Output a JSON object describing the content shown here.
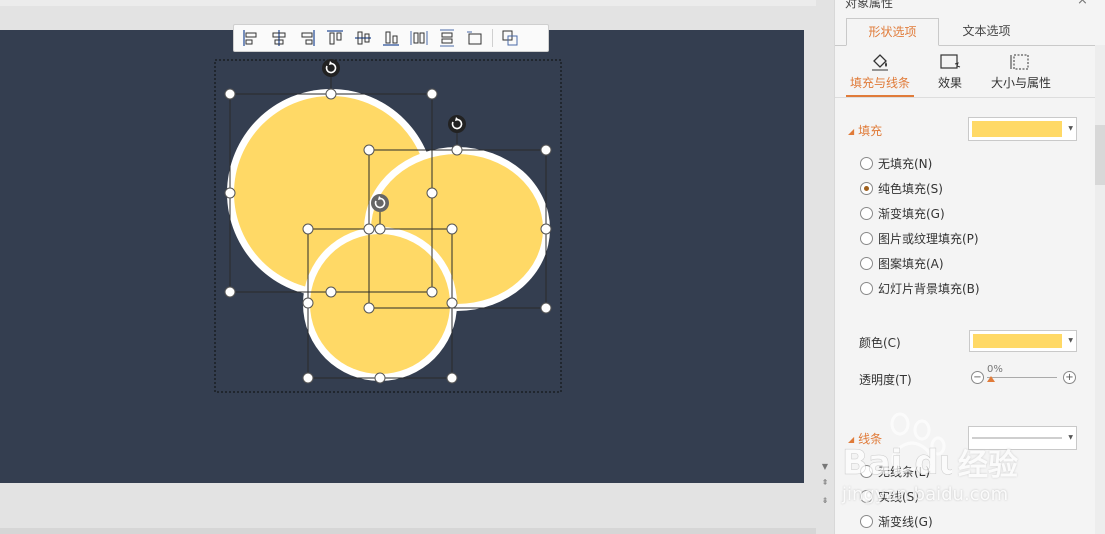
{
  "panel": {
    "title": "对象属性",
    "close": "×",
    "tabs": [
      "形状选项",
      "文本选项"
    ],
    "subtabs": [
      "填充与线条",
      "效果",
      "大小与属性"
    ],
    "fill": {
      "label": "填充",
      "color": "#ffd966",
      "options": [
        {
          "label": "无填充(N)",
          "checked": false
        },
        {
          "label": "纯色填充(S)",
          "checked": true
        },
        {
          "label": "渐变填充(G)",
          "checked": false
        },
        {
          "label": "图片或纹理填充(P)",
          "checked": false
        },
        {
          "label": "图案填充(A)",
          "checked": false
        },
        {
          "label": "幻灯片背景填充(B)",
          "checked": false
        }
      ],
      "color_label": "颜色(C)",
      "transparency_label": "透明度(T)",
      "transparency_value": "0%",
      "minus": "−",
      "plus": "+"
    },
    "line": {
      "label": "线条",
      "options": [
        {
          "label": "无线条(L)",
          "checked": false
        },
        {
          "label": "实线(S)",
          "checked": false
        },
        {
          "label": "渐变线(G)",
          "checked": false
        }
      ]
    }
  },
  "toolbar": {
    "buttons": [
      "align-left-icon",
      "align-center-icon",
      "align-right-icon",
      "align-top-icon",
      "align-middle-icon",
      "align-bottom-icon",
      "distribute-horizontal-icon",
      "distribute-vertical-icon",
      "equal-size-icon",
      "group-icon"
    ]
  },
  "colors": {
    "slide_bg": "#343e50",
    "circle_fill": "#ffd966",
    "circle_outline": "#ffffff",
    "accent": "#e07b39"
  },
  "watermark": {
    "logo": "Bai du",
    "text": "经验",
    "url": "jingyan.baidu.com"
  }
}
